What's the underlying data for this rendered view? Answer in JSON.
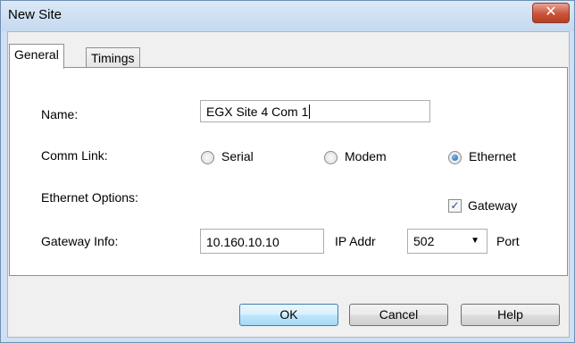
{
  "window": {
    "title": "New Site",
    "close_glyph": "✕"
  },
  "tabs": [
    {
      "label": "General",
      "active": true
    },
    {
      "label": "Timings",
      "active": false
    }
  ],
  "form": {
    "name_label": "Name:",
    "name_value": "EGX Site 4 Com 1",
    "comm_link_label": "Comm Link:",
    "comm_options": [
      {
        "label": "Serial",
        "selected": false
      },
      {
        "label": "Modem",
        "selected": false
      },
      {
        "label": "Ethernet",
        "selected": true
      }
    ],
    "ethernet_options_label": "Ethernet Options:",
    "gateway_checkbox": {
      "label": "Gateway",
      "checked": true
    },
    "gateway_info_label": "Gateway Info:",
    "ip_value": "10.160.10.10",
    "ip_label": "IP Addr",
    "port_value": "502",
    "port_label": "Port"
  },
  "buttons": {
    "ok": "OK",
    "cancel": "Cancel",
    "help": "Help"
  },
  "colors": {
    "title_bg": "#c5d9ef",
    "close_bg": "#c9533b",
    "selection": "#1a5fb4"
  }
}
